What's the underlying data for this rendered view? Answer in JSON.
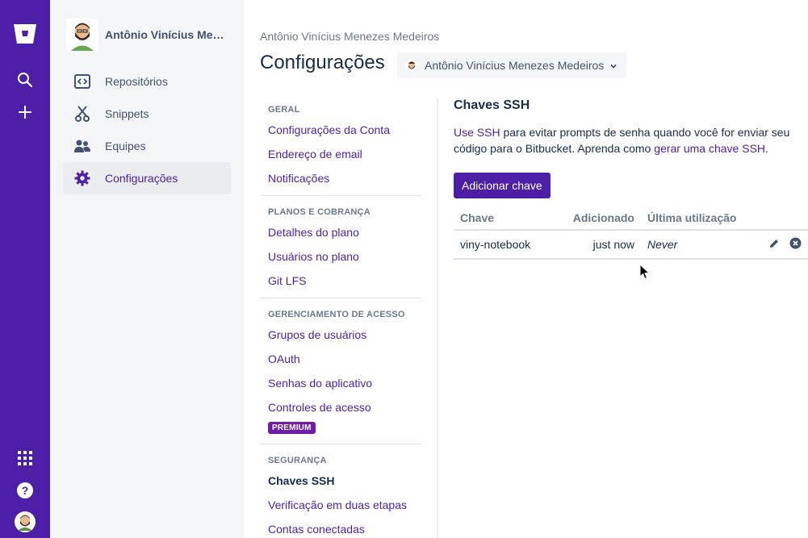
{
  "colors": {
    "brand": "#4c1fa6",
    "sidebar_bg": "#f4f5f7",
    "premium": "#6e1ea6"
  },
  "global_nav": {
    "icons": [
      "bitbucket-logo-icon",
      "search-icon",
      "plus-icon",
      "apps-grid-icon",
      "help-icon",
      "avatar"
    ]
  },
  "sidebar": {
    "user_name": "Antônio Vinícius Menezes Medeiros",
    "items": [
      {
        "label": "Repositórios",
        "icon": "repository-icon"
      },
      {
        "label": "Snippets",
        "icon": "snippets-icon"
      },
      {
        "label": "Equipes",
        "icon": "teams-icon"
      },
      {
        "label": "Configurações",
        "icon": "gear-icon",
        "active": true
      }
    ]
  },
  "header": {
    "breadcrumb": "Antônio Vinícius Menezes Medeiros",
    "title": "Configurações",
    "account_select": "Antônio Vinícius Menezes Medeiros"
  },
  "settings_nav": {
    "geral": {
      "heading": "GERAL",
      "links": [
        "Configurações da Conta",
        "Endereço de email",
        "Notificações"
      ]
    },
    "planos": {
      "heading": "PLANOS E COBRANÇA",
      "links": [
        "Detalhes do plano",
        "Usuários no plano",
        "Git LFS"
      ]
    },
    "acesso": {
      "heading": "GERENCIAMENTO DE ACESSO",
      "links": [
        "Grupos de usuários",
        "OAuth",
        "Senhas do aplicativo",
        "Controles de acesso"
      ],
      "premium_badge": "PREMIUM"
    },
    "seguranca": {
      "heading": "SEGURANÇA",
      "links": [
        "Chaves SSH",
        "Verificação em duas etapas",
        "Contas conectadas"
      ]
    }
  },
  "content": {
    "heading": "Chaves SSH",
    "desc": {
      "link1": "Use SSH",
      "text1": " para evitar prompts de senha quando você for enviar seu código para o Bitbucket. Aprenda como ",
      "link2": "gerar uma chave SSH",
      "text2": "."
    },
    "add_button": "Adicionar chave",
    "table": {
      "columns": [
        "Chave",
        "Adicionado",
        "Última utilização"
      ],
      "rows": [
        {
          "key": "viny-notebook",
          "added": "just now",
          "last_used": "Never"
        }
      ]
    }
  }
}
